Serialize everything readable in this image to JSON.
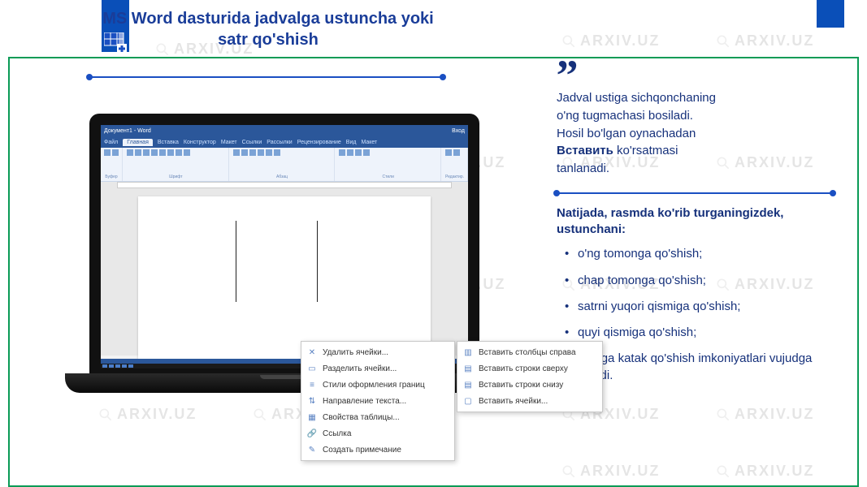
{
  "header": {
    "title": "MS Word dasturida jadvalga ustuncha yoki satr qo'shish"
  },
  "intro": {
    "quote_mark": "„",
    "line1": "Jadval ustiga sichqonchaning",
    "line2": "o'ng tugmachasi bosiladi.",
    "line3": "Hosil bo'lgan oynachadan",
    "bold_word": "Вставить",
    "line4": " ko'rsatmasi",
    "line5": "tanlanadi."
  },
  "result": {
    "heading": "Natijada, rasmda ko'rib turganingizdek, ustunchani:",
    "bullets": [
      "o'ng tomonga qo'shish;",
      "chap tomonga qo'shish;",
      "satrni yuqori qismiga qo'shish;",
      "quyi qismiga qo'shish;",
      "o'rtaga katak qo'shish imkoniyatlari vujudga keladi."
    ]
  },
  "word_ui": {
    "titlebar_left": "Документ1 - Word",
    "titlebar_right": "Вход",
    "tabs": [
      "Файл",
      "Главная",
      "Вставка",
      "Конструктор",
      "Макет",
      "Ссылки",
      "Рассылки",
      "Рецензирование",
      "Вид",
      "Макет"
    ],
    "active_tab": "Главная",
    "ribbon_groups": [
      "Буфер",
      "Шрифт",
      "Абзац",
      "Стили",
      "Редактир."
    ]
  },
  "context_menu_main": [
    {
      "icon": "✕",
      "label": "Удалить ячейки..."
    },
    {
      "icon": "▭",
      "label": "Разделить ячейки..."
    },
    {
      "icon": "≡",
      "label": "Стили оформления границ"
    },
    {
      "icon": "⇅",
      "label": "Направление текста..."
    },
    {
      "icon": "▦",
      "label": "Свойства таблицы..."
    },
    {
      "icon": "🔗",
      "label": "Ссылка"
    },
    {
      "icon": "✎",
      "label": "Создать примечание"
    }
  ],
  "context_menu_sub": [
    {
      "icon": "▥",
      "label": "Вставить столбцы справа"
    },
    {
      "icon": "▤",
      "label": "Вставить строки сверху"
    },
    {
      "icon": "▤",
      "label": "Вставить строки снизу"
    },
    {
      "icon": "▢",
      "label": "Вставить ячейки..."
    }
  ],
  "watermark_text": "ARXIV.UZ"
}
